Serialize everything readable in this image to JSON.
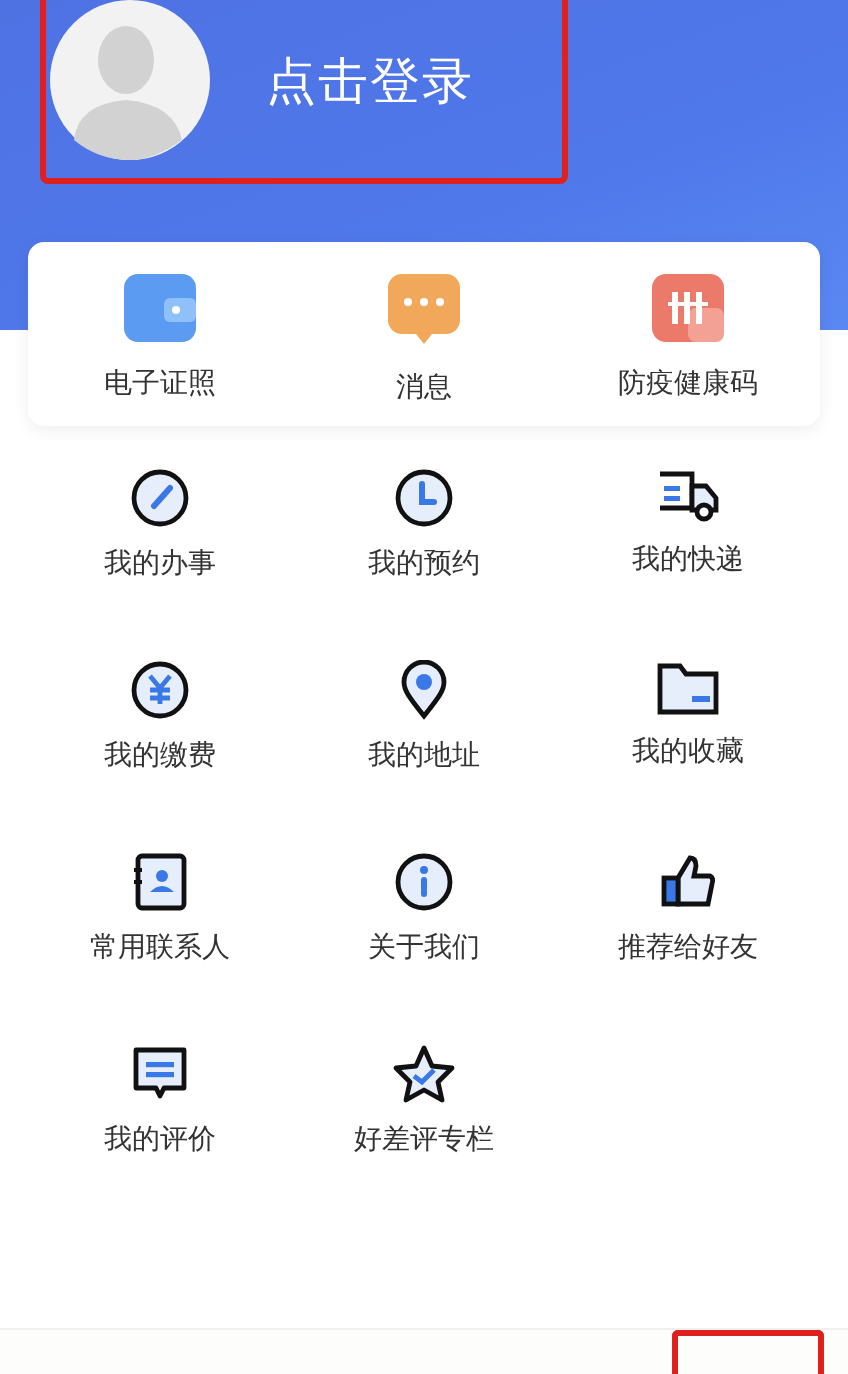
{
  "header": {
    "login_label": "点击登录",
    "highlighted": true
  },
  "quick_actions": [
    {
      "label": "电子证照"
    },
    {
      "label": "消息"
    },
    {
      "label": "防疫健康码"
    }
  ],
  "menu_items": [
    {
      "label": "我的办事"
    },
    {
      "label": "我的预约"
    },
    {
      "label": "我的快递"
    },
    {
      "label": "我的缴费"
    },
    {
      "label": "我的地址"
    },
    {
      "label": "我的收藏"
    },
    {
      "label": "常用联系人"
    },
    {
      "label": "关于我们"
    },
    {
      "label": "推荐给好友"
    },
    {
      "label": "我的评价"
    },
    {
      "label": "好差评专栏"
    }
  ],
  "bottom_bar": {
    "highlighted": true
  }
}
